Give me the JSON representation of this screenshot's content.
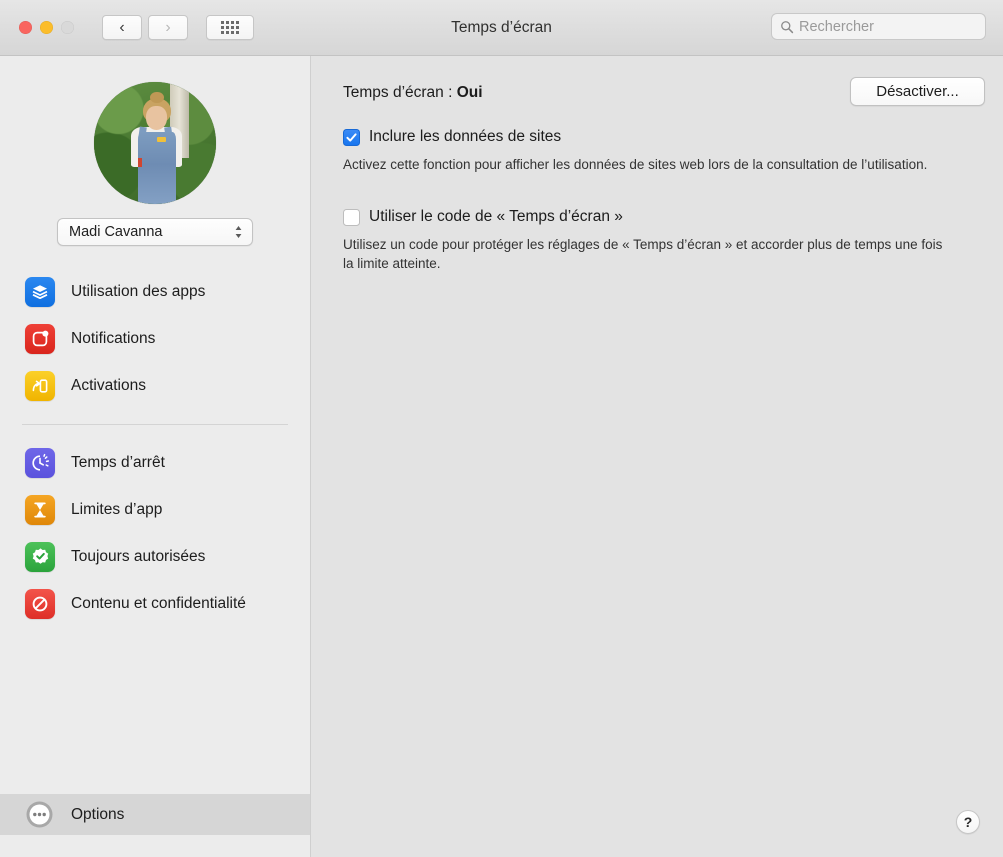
{
  "window": {
    "title": "Temps d’écran",
    "traffic_lights": [
      "close-red",
      "minimize-yellow",
      "zoom-disabled"
    ]
  },
  "toolbar": {
    "back_icon": "chevron-left-icon",
    "forward_icon": "chevron-right-icon",
    "grid_icon": "show-all-grid-icon",
    "search": {
      "icon": "search-icon",
      "placeholder": "Rechercher",
      "value": ""
    }
  },
  "sidebar": {
    "avatar": {
      "icon": "user-avatar-photo",
      "alt": "Photo de profil"
    },
    "user_popup": {
      "selected": "Madi Cavanna",
      "chevron_icon": "chevron-up-down-icon"
    },
    "group_one": [
      {
        "label": "Utilisation des apps",
        "icon": "app-usage-icon"
      },
      {
        "label": "Notifications",
        "icon": "notifications-icon"
      },
      {
        "label": "Activations",
        "icon": "pickups-icon"
      }
    ],
    "group_two": [
      {
        "label": "Temps d’arrêt",
        "icon": "downtime-icon"
      },
      {
        "label": "Limites d’app",
        "icon": "app-limits-icon"
      },
      {
        "label": "Toujours autorisées",
        "icon": "always-allowed-icon"
      },
      {
        "label": "Contenu et confidentialité",
        "icon": "content-privacy-icon"
      }
    ],
    "options": {
      "label": "Options",
      "icon": "options-ellipsis-icon",
      "selected": true
    }
  },
  "main": {
    "status_prefix": "Temps d’écran : ",
    "status_value": "Oui",
    "disable_button": "Désactiver...",
    "checkbox_sites": {
      "label": "Inclure les données de sites",
      "checked": true,
      "help": "Activez cette fonction pour afficher les données de sites web lors de la consultation de l’utilisation."
    },
    "checkbox_passcode": {
      "label": "Utiliser le code de « Temps d’écran »",
      "checked": false,
      "help": "Utilisez un code pour protéger les réglages de « Temps d’écran » et accorder plus de temps une fois la limite atteinte."
    },
    "help_button": "?"
  },
  "colors": {
    "accent_blue": "#1876ef",
    "sidebar_bg": "#ececec",
    "content_bg": "#e3e3e3",
    "selected_row": "#d6d6d6",
    "icon_apps": "#0f6fe0",
    "icon_notifications": "#d9251c",
    "icon_pickups": "#f0b400",
    "icon_downtime": "#5b52dd",
    "icon_limits": "#df8709",
    "icon_allowed": "#2ba33c",
    "icon_content": "#de2f28"
  }
}
